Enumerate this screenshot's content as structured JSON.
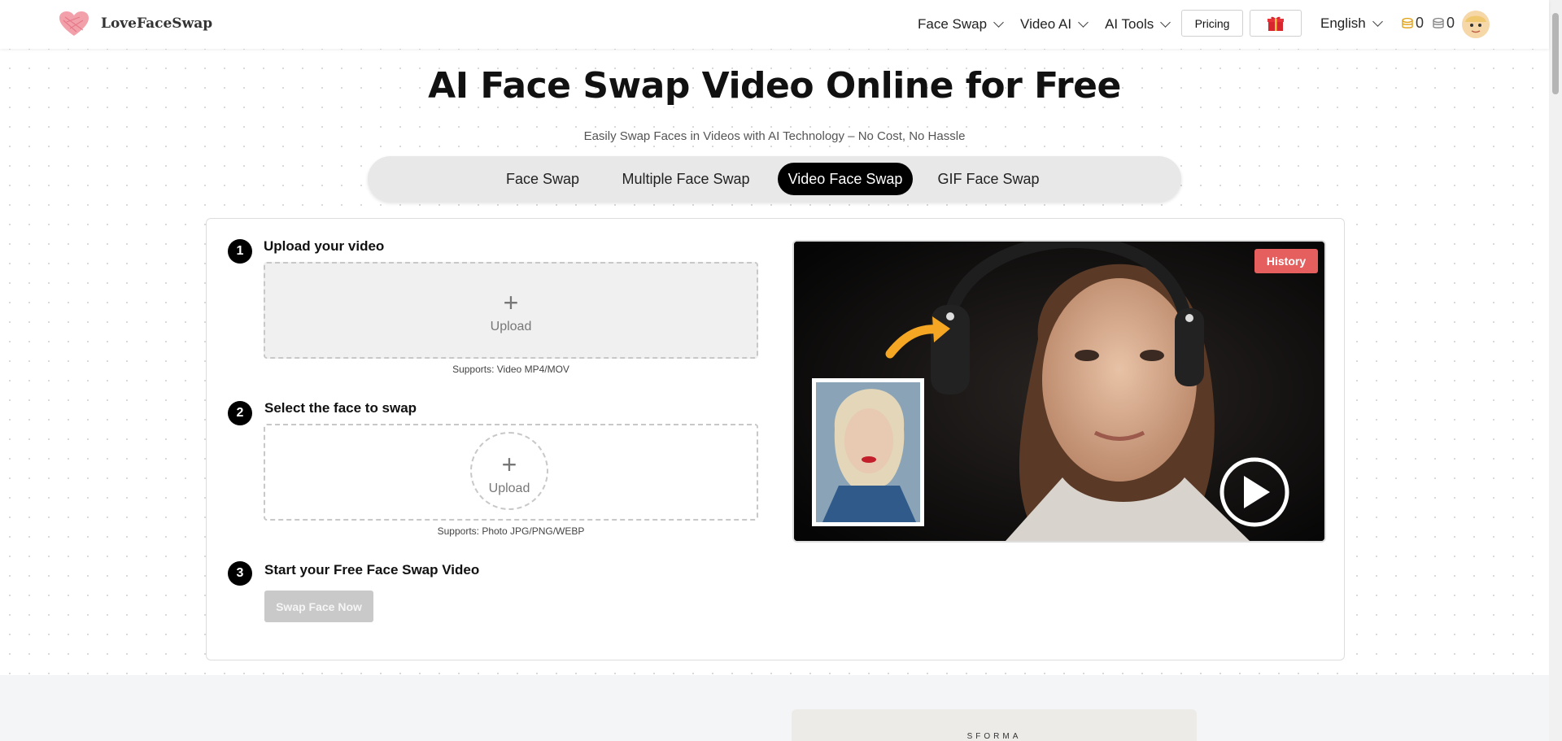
{
  "header": {
    "brand": "LoveFaceSwap",
    "nav": [
      {
        "label": "Face Swap"
      },
      {
        "label": "Video AI"
      },
      {
        "label": "AI Tools"
      }
    ],
    "pricing": "Pricing",
    "language": "English",
    "credits_a": "0",
    "credits_b": "0"
  },
  "hero": {
    "title": "AI Face Swap Video Online for Free",
    "subtitle": "Easily Swap Faces in Videos with AI Technology – No Cost, No Hassle"
  },
  "tabs": [
    "Face Swap",
    "Multiple Face Swap",
    "Video Face Swap",
    "GIF Face Swap"
  ],
  "active_tab": "Video Face Swap",
  "steps": {
    "s1": {
      "num": "1",
      "title": "Upload your video",
      "upload": "Upload",
      "supports": "Supports: Video MP4/MOV"
    },
    "s2": {
      "num": "2",
      "title": "Select the face to swap",
      "upload": "Upload",
      "supports": "Supports: Photo JPG/PNG/WEBP"
    },
    "s3": {
      "num": "3",
      "title": "Start your Free Face Swap Video",
      "button": "Swap Face Now"
    }
  },
  "preview": {
    "history": "History"
  },
  "lower": {
    "snippet": "SFORMA"
  },
  "colors": {
    "history": "#e55f5f",
    "tab_active": "#000000",
    "arrow": "#f5a623"
  }
}
